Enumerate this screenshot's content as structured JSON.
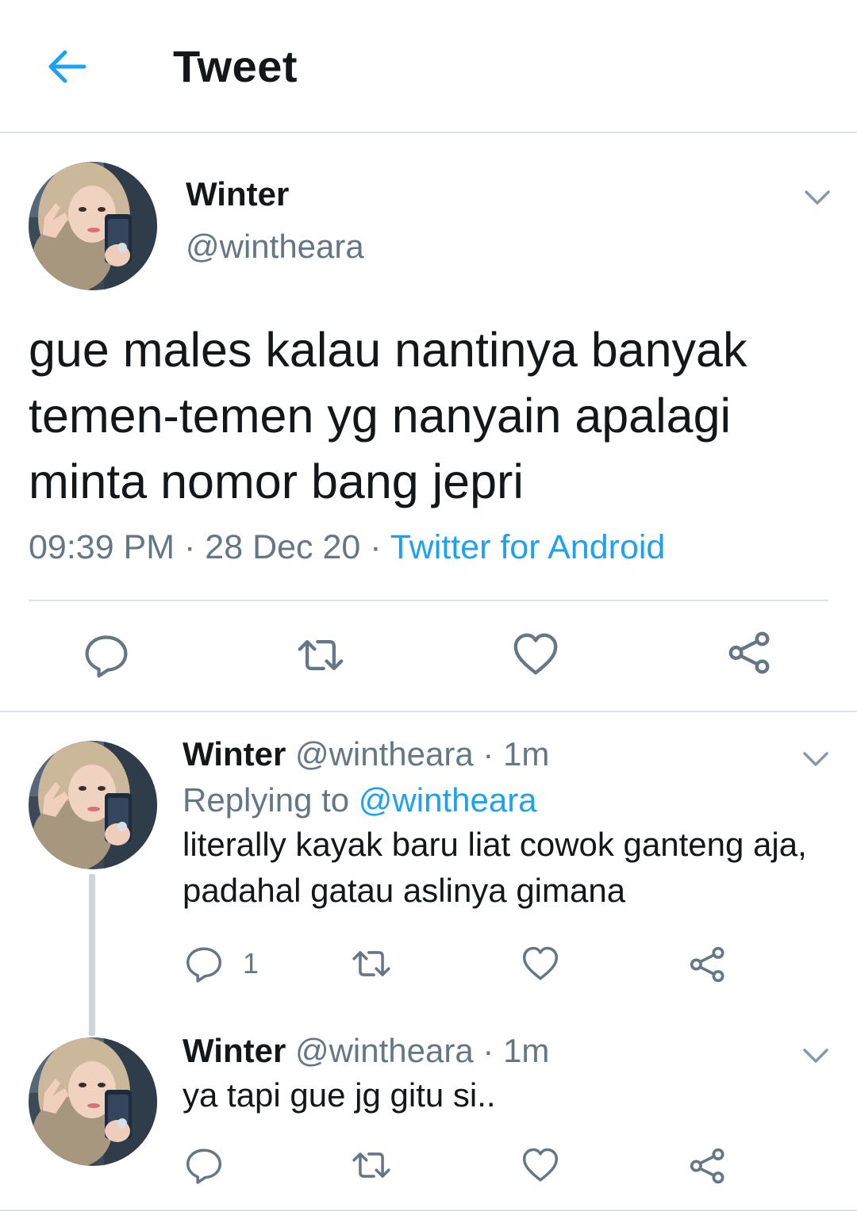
{
  "header": {
    "title": "Tweet",
    "back_icon": "arrow-left-icon",
    "accent_color": "#1da1f2"
  },
  "main_tweet": {
    "name": "Winter",
    "handle": "@wintheara",
    "text": "gue males kalau nantinya banyak temen-temen yg nanyain apalagi minta nomor bang jepri",
    "time": "09:39 PM",
    "date": "28 Dec 20",
    "source": "Twitter for Android",
    "actions": [
      "reply-icon",
      "retweet-icon",
      "like-icon",
      "share-icon"
    ]
  },
  "replies": [
    {
      "name": "Winter",
      "handle": "@wintheara",
      "time": "1m",
      "replying_prefix": "Replying to",
      "replying_to": "@wintheara",
      "text": "literally kayak baru liat cowok ganteng aja, padahal gatau aslinya gimana",
      "reply_count": "1"
    },
    {
      "name": "Winter",
      "handle": "@wintheara",
      "time": "1m",
      "text": "ya tapi gue jg gitu si.."
    }
  ],
  "separator": "·"
}
